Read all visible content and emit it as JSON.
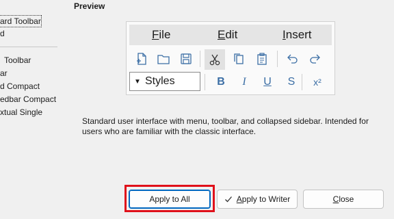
{
  "layout_list": {
    "items": [
      {
        "label": "ard Toolbar",
        "selected": true
      },
      {
        "label": "d"
      },
      {
        "label": "Toolbar"
      },
      {
        "label": "ar"
      },
      {
        "label": "d Compact"
      },
      {
        "label": "edbar Compact"
      },
      {
        "label": "xtual Single"
      }
    ]
  },
  "preview": {
    "label": "Preview",
    "menu": [
      {
        "before": "",
        "mnemonic": "F",
        "after": "ile"
      },
      {
        "before": "",
        "mnemonic": "E",
        "after": "dit"
      },
      {
        "before": "",
        "mnemonic": "I",
        "after": "nsert"
      }
    ],
    "styles_label": "Styles",
    "styles_arrow": "▼",
    "format_buttons": [
      {
        "name": "bold",
        "glyph": "B"
      },
      {
        "name": "italic",
        "glyph": "I"
      },
      {
        "name": "underline",
        "glyph": "U"
      },
      {
        "name": "strikethrough",
        "glyph": "S"
      },
      {
        "name": "superscript",
        "glyph": "x²"
      }
    ]
  },
  "description": "Standard user interface with menu, toolbar, and collapsed sidebar. Intended for users who are familiar with the classic interface.",
  "buttons": {
    "apply_all": "Apply to All",
    "apply_writer_mnemonic": "A",
    "apply_writer_rest": "pply to Writer",
    "close_mnemonic": "C",
    "close_rest": "lose"
  },
  "colors": {
    "highlight": "#e0101a",
    "accent": "#0067c0",
    "icon_blue": "#3b6ea5"
  }
}
